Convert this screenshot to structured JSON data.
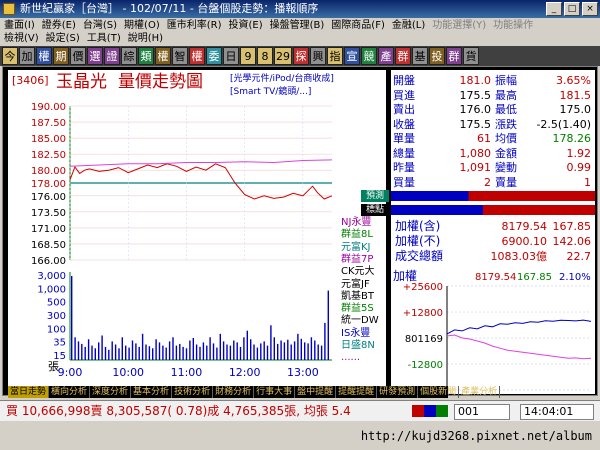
{
  "window": {
    "title": "新世紀贏家［台灣］ - 102/07/11 - 台盤個股走勢：播報順序",
    "buttons": [
      "_",
      "□",
      "×"
    ]
  },
  "menu": {
    "row1": [
      "畫面(I)",
      "證券(E)",
      "台灣(S)",
      "期權(O)",
      "匯市利率(R)",
      "投資(E)",
      "操盤管理(B)",
      "國際商品(F)",
      "金融(L)",
      "功能選擇(Y)",
      "功能操作"
    ],
    "row2": [
      "檢視(V)",
      "設定(S)",
      "工具(T)",
      "說明(H)"
    ]
  },
  "toolbar": {
    "buttons": [
      "今",
      "加",
      "權",
      "期",
      "價",
      "選",
      "證",
      "綜",
      "類",
      "權",
      "智",
      "權",
      "委",
      "日",
      "9",
      "8",
      "29",
      "探",
      "興",
      "指",
      "宣",
      "競",
      "產",
      "群",
      "基",
      "投",
      "群",
      "貨"
    ]
  },
  "stock": {
    "code": "[3406]",
    "name": "玉晶光",
    "chart_title": "量價走勢圖",
    "tags_line1": "[光學元件/iPod/台商收成]",
    "tags_line2": "[Smart TV/鏡頭/...]"
  },
  "chart_data": [
    {
      "type": "line",
      "xlabel": "",
      "ylabel": "",
      "x": [
        "9:00",
        "10:00",
        "11:00",
        "12:00",
        "13:00"
      ],
      "xlim": [
        0,
        270
      ],
      "ylim": [
        166.0,
        190.0
      ],
      "y_ticks": [
        "190.00",
        "187.50",
        "185.00",
        "182.50",
        "180.00",
        "178.00",
        "176.00",
        "173.50",
        "171.00",
        "168.50",
        "166.00"
      ],
      "reference_line": 178.0,
      "series": [
        {
          "color": "#d00000",
          "points": [
            [
              0,
              178.5
            ],
            [
              5,
              180.5
            ],
            [
              10,
              179.5
            ],
            [
              15,
              180.0
            ],
            [
              20,
              180.2
            ],
            [
              30,
              179.8
            ],
            [
              40,
              180.0
            ],
            [
              50,
              180.4
            ],
            [
              60,
              179.6
            ],
            [
              70,
              180.2
            ],
            [
              80,
              180.8
            ],
            [
              90,
              180.4
            ],
            [
              100,
              181.0
            ],
            [
              110,
              180.6
            ],
            [
              120,
              179.8
            ],
            [
              130,
              180.5
            ],
            [
              140,
              180.0
            ],
            [
              150,
              181.0
            ],
            [
              160,
              180.4
            ],
            [
              170,
              178.0
            ],
            [
              180,
              176.2
            ],
            [
              190,
              175.5
            ],
            [
              200,
              176.0
            ],
            [
              210,
              175.6
            ],
            [
              220,
              175.8
            ],
            [
              230,
              176.4
            ],
            [
              240,
              176.0
            ],
            [
              250,
              177.5
            ],
            [
              255,
              176.5
            ],
            [
              262,
              175.5
            ],
            [
              270,
              176.0
            ]
          ]
        },
        {
          "color": "#e040e0",
          "points": [
            [
              0,
              180.6
            ],
            [
              30,
              180.8
            ],
            [
              60,
              181.0
            ],
            [
              90,
              181.0
            ],
            [
              120,
              181.2
            ],
            [
              150,
              181.2
            ],
            [
              180,
              181.3
            ],
            [
              210,
              181.2
            ],
            [
              240,
              181.5
            ],
            [
              270,
              181.6
            ]
          ]
        }
      ]
    },
    {
      "type": "bar",
      "xlabel": "",
      "ylabel": "張",
      "ylim": [
        0,
        3000
      ],
      "y_ticks": [
        "3,000",
        "1,000",
        "500",
        "300",
        "100",
        "35",
        "15"
      ],
      "values": [
        410,
        30,
        20,
        15,
        10,
        25,
        12,
        8,
        18,
        35,
        10,
        6,
        20,
        14,
        8,
        30,
        12,
        9,
        22,
        16,
        10,
        40,
        14,
        11,
        8,
        25,
        18,
        12,
        9,
        20,
        30,
        12,
        15,
        10,
        8,
        22,
        28,
        14,
        10,
        18,
        12,
        30,
        16,
        9,
        40,
        20,
        14,
        12,
        22,
        18,
        10,
        30,
        50,
        25,
        14,
        9,
        16,
        20,
        12,
        70,
        30,
        15,
        22,
        18,
        24,
        14,
        20,
        40,
        26,
        18,
        16,
        30,
        22,
        14,
        12,
        80,
        280
      ]
    },
    {
      "type": "line",
      "xlabel": "",
      "ylabel": "",
      "ylim": [
        -25600,
        25600
      ],
      "y_ticks": [
        "+25600",
        "+12800",
        "0",
        "-12800",
        "-25600"
      ],
      "series": [
        {
          "color": "#0000c0",
          "values": [
            2000,
            4000,
            3500,
            5000,
            4500,
            6000,
            5500,
            7000,
            6800,
            7500,
            7200,
            8000,
            7800,
            8500,
            8200,
            8700,
            8600,
            8400,
            8800,
            8179
          ]
        },
        {
          "color": "#e040e0",
          "values": [
            1000,
            1500,
            0,
            -500,
            -1500,
            -2500,
            -4000,
            -5000,
            -6000,
            -6500,
            -7000,
            -7500,
            -8000,
            -8500,
            -9000,
            -9500,
            -10000,
            -9800,
            -10200,
            -10000
          ]
        }
      ]
    }
  ],
  "quote": {
    "rows": [
      {
        "k1": "開盤",
        "v1": "181.0",
        "k2": "振幅",
        "v2": "3.65%",
        "c1": "#c00000",
        "c2": "#c00000"
      },
      {
        "k1": "買進",
        "v1": "175.5",
        "k2": "最高",
        "v2": "181.5",
        "c1": "#000000",
        "c2": "#c00000"
      },
      {
        "k1": "賣出",
        "v1": "176.0",
        "k2": "最低",
        "v2": "175.0",
        "c1": "#000000",
        "c2": "#000000"
      },
      {
        "k1": "收盤",
        "v1": "175.5",
        "k2": "漲跌",
        "v2": "-2.5(1.40)",
        "c1": "#000000",
        "c2": "#000000"
      },
      {
        "k1": "單量",
        "v1": "61",
        "k2": "均價",
        "v2": "178.26",
        "c1": "#c00000",
        "c2": "#008000"
      },
      {
        "k1": "總量",
        "v1": "1,080",
        "k2": "金額",
        "v2": "1.92",
        "c1": "#c00000",
        "c2": "#c00000"
      },
      {
        "k1": "昨量",
        "v1": "1,091",
        "k2": "變動",
        "v2": "0.99",
        "c1": "#c00000",
        "c2": "#c00000"
      },
      {
        "k1": "買量",
        "v1": "2",
        "k2": "賣量",
        "v2": "1",
        "c1": "#c00000",
        "c2": "#c00000"
      }
    ]
  },
  "brokers": {
    "header1": "預測",
    "header2": "標點",
    "items": [
      {
        "name": "NJ永豐",
        "color": "#a000a0"
      },
      {
        "name": "群益8L",
        "color": "#008000"
      },
      {
        "name": "元富KJ",
        "color": "#008080"
      },
      {
        "name": "群益7P",
        "color": "#a000a0"
      },
      {
        "name": "CK元大",
        "color": "#000000"
      },
      {
        "name": "元富JF",
        "color": "#000000"
      },
      {
        "name": "凱基BT",
        "color": "#000000"
      },
      {
        "name": "群益5S",
        "color": "#008000"
      },
      {
        "name": "統一DW",
        "color": "#000000"
      },
      {
        "name": "IS永豐",
        "color": "#0000c0"
      },
      {
        "name": "日盛8N",
        "color": "#008080"
      },
      {
        "name": "......",
        "color": "#a000a0"
      }
    ],
    "bar_colors": [
      "#c00000",
      "#0000c0"
    ]
  },
  "index": {
    "rows": [
      {
        "k": "加權(含)",
        "v1": "8179.54",
        "v2": "167.85"
      },
      {
        "k": "加權(不)",
        "v1": "6900.10",
        "v2": "142.06"
      },
      {
        "k": "成交總額",
        "v1": "1083.03億",
        "v2": "22.7"
      }
    ],
    "mini_label": "加權",
    "mini_v1": "8179.54",
    "mini_v2": "167.85",
    "mini_pct": "2.10%",
    "mini_center_label": "801169"
  },
  "tabs": [
    "當日走勢",
    "橫向分析",
    "深度分析",
    "基本分析",
    "技術分析",
    "財務分析",
    "行事大事",
    "盤中提醒",
    "提醒提醒",
    "研發預測",
    "個股新聞",
    "產業分析"
  ],
  "status": {
    "text": "買 10,666,998賣 8,305,587( 0.78)成 4,765,385張, 均張 5.4",
    "code_box": "001",
    "time_box": "14:04:01"
  },
  "footer": {
    "text": "http://kujd3268.pixnet.net/album"
  }
}
